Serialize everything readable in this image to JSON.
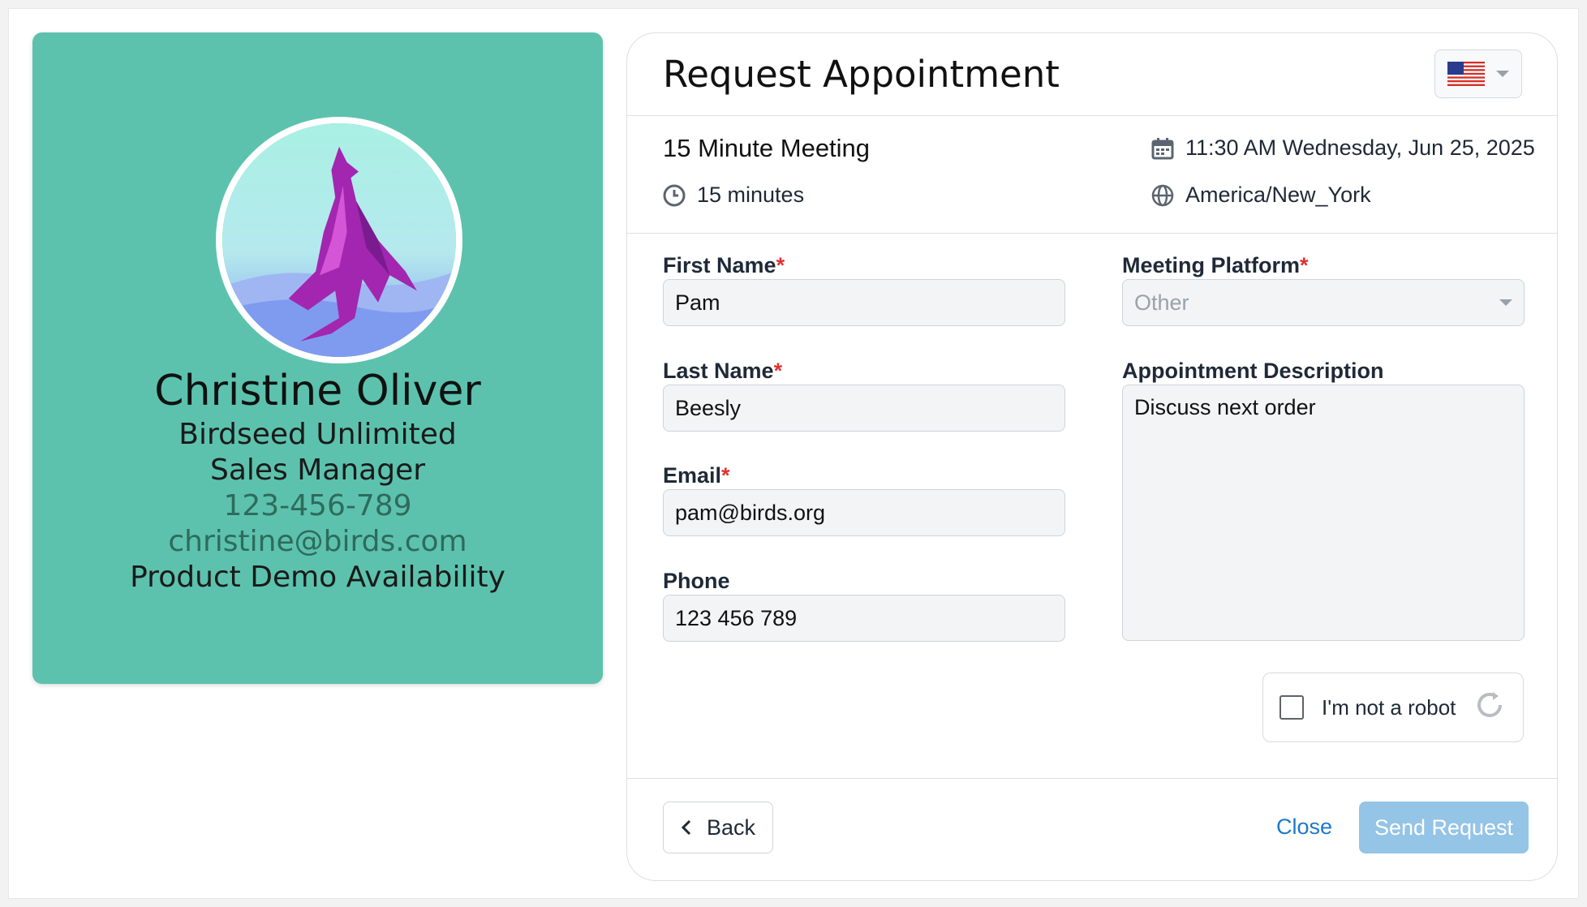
{
  "colors": {
    "profile_bg": "#5cc2ad",
    "accent": "#1e78c8",
    "send_button": "#94c4e6",
    "required": "#e03131"
  },
  "profile": {
    "name": "Christine Oliver",
    "company": "Birdseed Unlimited",
    "role": "Sales Manager",
    "phone": "123-456-789",
    "email": "christine@birds.com",
    "event": "Product Demo Availability",
    "avatar_icon": "dragon-avatar"
  },
  "header": {
    "title": "Request Appointment",
    "language_icon": "us-flag-icon"
  },
  "meeting": {
    "title": "15 Minute Meeting",
    "duration": "15 minutes",
    "datetime": "11:30 AM Wednesday, Jun 25, 2025",
    "timezone": "America/New_York"
  },
  "form": {
    "required_mark": "*",
    "first_name": {
      "label": "First Name",
      "value": "Pam"
    },
    "last_name": {
      "label": "Last Name",
      "value": "Beesly"
    },
    "email": {
      "label": "Email",
      "value": "pam@birds.org"
    },
    "phone": {
      "label": "Phone",
      "value": "123 456 789"
    },
    "platform": {
      "label": "Meeting Platform",
      "value": "Other"
    },
    "description": {
      "label": "Appointment Description",
      "value": "Discuss next order"
    },
    "captcha": {
      "label": "I'm not a robot"
    }
  },
  "footer": {
    "back": "Back",
    "close": "Close",
    "send": "Send Request"
  }
}
